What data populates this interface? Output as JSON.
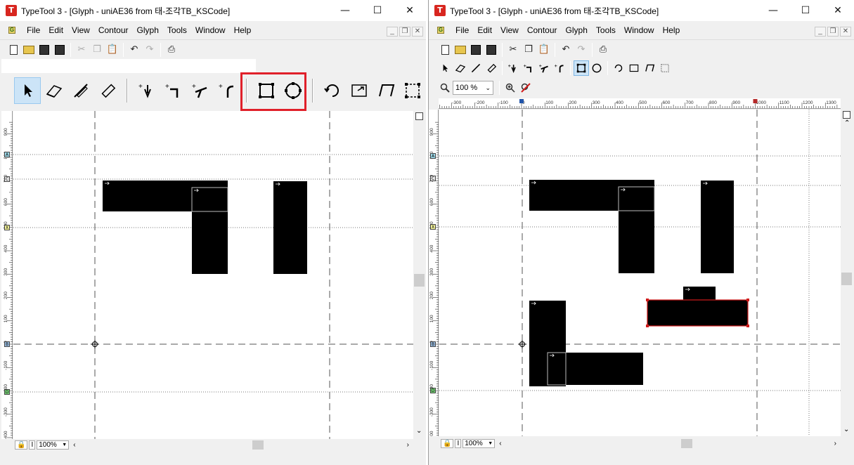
{
  "windows": [
    {
      "title": "TypeTool 3 - [Glyph - uniAE36 from 태-조각TB_KSCode]",
      "menu": [
        "File",
        "Edit",
        "View",
        "Contour",
        "Glyph",
        "Tools",
        "Window",
        "Help"
      ],
      "zoom": "100%"
    },
    {
      "title": "TypeTool 3 - [Glyph - uniAE36 from 태-조각TB_KSCode]",
      "menu": [
        "File",
        "Edit",
        "View",
        "Contour",
        "Glyph",
        "Tools",
        "Window",
        "Help"
      ],
      "zoom": "100 %",
      "status_zoom": "100%"
    }
  ],
  "app_icon_letter": "T",
  "window_buttons": {
    "minimize": "—",
    "maximize": "☐",
    "close": "✕"
  },
  "left_ruler_labels": [
    "900",
    "800",
    "700",
    "600",
    "500",
    "400",
    "300",
    "200",
    "100",
    "0",
    "-100",
    "-200",
    "-300",
    "-400"
  ],
  "top_ruler_labels": [
    "-300",
    "-200",
    "-100",
    "0",
    "100",
    "200",
    "300",
    "400",
    "500",
    "600",
    "700",
    "800",
    "900",
    "1000",
    "1100",
    "1200",
    "1300"
  ],
  "guide_markers": [
    "A",
    "C",
    "X",
    "B",
    "D"
  ],
  "status_left_zoom": "100%",
  "colors": {
    "glyph": "#000000",
    "selection": "#d01a1a",
    "highlight": "#e0202a",
    "active_tool": "#cce4f7"
  }
}
